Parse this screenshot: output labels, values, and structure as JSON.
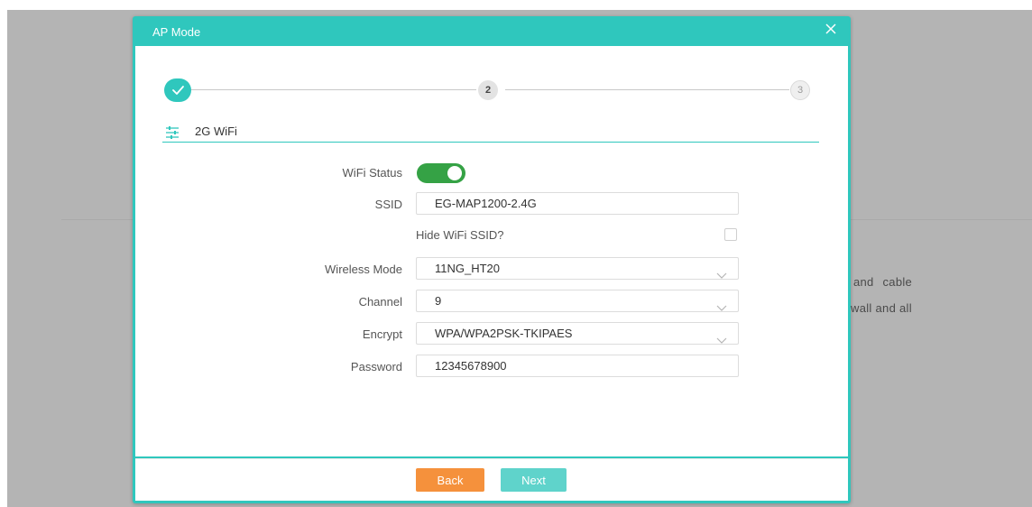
{
  "background": {
    "text_line1": "and  cable",
    "text_line2": "wall and all"
  },
  "modal": {
    "title": "AP Mode",
    "close_icon": "close-icon"
  },
  "steps": [
    {
      "label": "",
      "state": "done",
      "icon": "check-icon"
    },
    {
      "label": "2",
      "state": "current"
    },
    {
      "label": "3",
      "state": "pending"
    }
  ],
  "section": {
    "title": "2G WiFi",
    "icon": "sliders-icon"
  },
  "form": {
    "wifi_status": {
      "label": "WiFi Status",
      "value": true
    },
    "ssid": {
      "label": "SSID",
      "value": "EG-MAP1200-2.4G"
    },
    "hide_ssid": {
      "label": "Hide WiFi SSID?",
      "checked": false
    },
    "wireless_mode": {
      "label": "Wireless Mode",
      "value": "11NG_HT20"
    },
    "channel": {
      "label": "Channel",
      "value": "9"
    },
    "encrypt": {
      "label": "Encrypt",
      "value": "WPA/WPA2PSK-TKIPAES"
    },
    "password": {
      "label": "Password",
      "value": "12345678900"
    }
  },
  "footer": {
    "back_label": "Back",
    "next_label": "Next"
  },
  "colors": {
    "accent": "#2fc7bd",
    "toggle_on": "#35a245",
    "back_button": "#f5913c",
    "next_button": "#5fd3cb"
  }
}
